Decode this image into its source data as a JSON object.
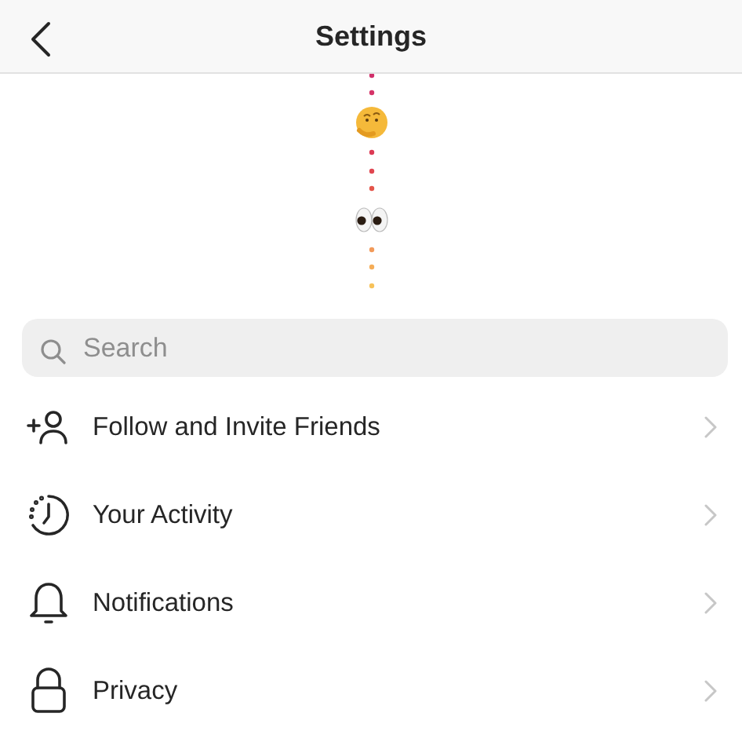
{
  "header": {
    "title": "Settings"
  },
  "search": {
    "placeholder": "Search"
  },
  "items": [
    {
      "kind": "follow",
      "label": "Follow and Invite Friends"
    },
    {
      "kind": "activity",
      "label": "Your Activity"
    },
    {
      "kind": "notifications",
      "label": "Notifications"
    },
    {
      "kind": "privacy",
      "label": "Privacy"
    }
  ]
}
